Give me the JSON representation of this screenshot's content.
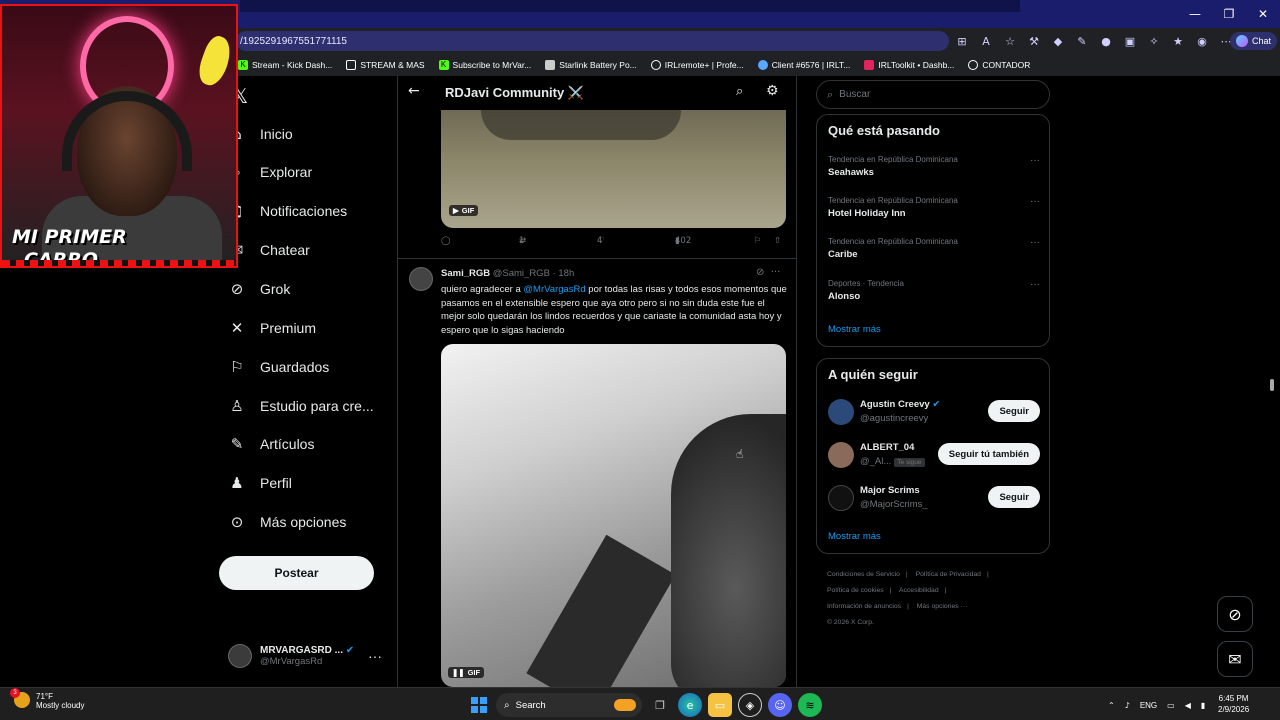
{
  "browser": {
    "url": "/1925291967551771115",
    "chat_label": "Chat",
    "bookmarks": [
      "Stream - Kick Dash...",
      "STREAM & MAS",
      "Subscribe to MrVar...",
      "Starlink Battery Po...",
      "IRLremote+ | Profe...",
      "Client #6576 | IRLT...",
      "IRLToolkit • Dashb...",
      "CONTADOR"
    ]
  },
  "nav": {
    "items": [
      "Inicio",
      "Explorar",
      "Notificaciones",
      "Chatear",
      "Grok",
      "Premium",
      "Guardados",
      "Estudio para cre...",
      "Artículos",
      "Perfil",
      "Más opciones"
    ],
    "post_label": "Postear",
    "account_name": "MRVARGASRD ...",
    "account_handle": "@MrVargasRd"
  },
  "feed": {
    "title": "RDJavi Community ⚔️",
    "tweet1": {
      "gif_label": "GIF",
      "retweets": "1",
      "likes": "4",
      "views": "402"
    },
    "tweet2": {
      "name": "Sami_RGB",
      "handle": "@Sami_RGB",
      "time": "18h",
      "text_before": "quiero agradecer a ",
      "mention": "@MrVargasRd",
      "text_after": " por todas las risas y todos esos momentos que pasamos en el extensible espero que aya otro pero si no sin duda este fue el mejor solo quedarán los lindos recuerdos y que cariaste  la comunidad asta hoy y espero que lo sigas haciendo",
      "gif_label": "GIF"
    }
  },
  "sidebar": {
    "search_placeholder": "Buscar",
    "trends_title": "Qué está pasando",
    "trends": [
      {
        "context": "Tendencia en República Dominicana",
        "name": "Seahawks"
      },
      {
        "context": "Tendencia en República Dominicana",
        "name": "Hotel Holiday Inn"
      },
      {
        "context": "Tendencia en República Dominicana",
        "name": "Caribe"
      },
      {
        "context": "Deportes · Tendencia",
        "name": "Alonso"
      }
    ],
    "show_more": "Mostrar más",
    "follow_title": "A quién seguir",
    "follows": [
      {
        "name": "Agustin Creevy",
        "handle": "@agustincreevy",
        "button": "Seguir",
        "verified": true
      },
      {
        "name": "ALBERT_04",
        "handle": "@_Al...",
        "button": "Seguir tú también",
        "badge": "Te sigue"
      },
      {
        "name": "Major Scrims",
        "handle": "@MajorScrims_",
        "button": "Seguir"
      }
    ],
    "follow_more": "Mostrar más",
    "legal": [
      "Condiciones de Servicio",
      "|",
      "Política de Privacidad",
      "|",
      "Política de cookies",
      "|",
      "Accesibilidad",
      "|",
      "Información de anuncios",
      "|",
      "Más opciones ···",
      "© 2026 X Corp."
    ]
  },
  "overlay": {
    "caption_line1": "MI PRIMER",
    "caption_line2": "CARRO"
  },
  "taskbar": {
    "weather_temp": "71°F",
    "weather_desc": "Mostly cloudy",
    "weather_badge": "3",
    "search_label": "Search",
    "lang": "ENG",
    "time": "6:45 PM",
    "date": "2/9/2026"
  },
  "colors": {
    "accent": "#1d9bf0",
    "browser_frame": "#1a1d6b"
  }
}
